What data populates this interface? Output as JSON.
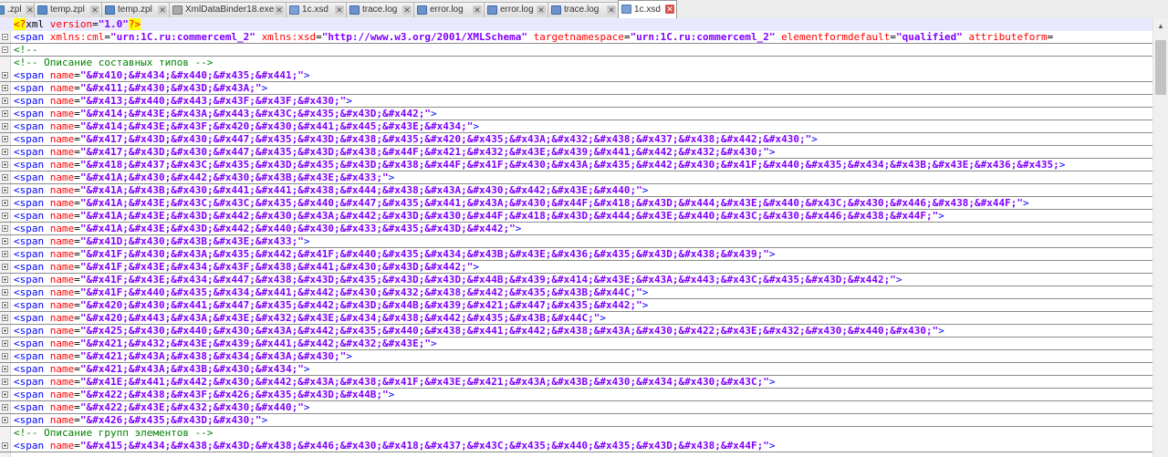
{
  "tabs": [
    {
      "label": ".zpl",
      "type": "zpl",
      "active": false
    },
    {
      "label": "temp.zpl",
      "type": "zpl",
      "active": false
    },
    {
      "label": "temp.zpl",
      "type": "zpl",
      "active": false
    },
    {
      "label": "XmlDataBinder18.exe",
      "type": "exe",
      "active": false
    },
    {
      "label": "1c.xsd",
      "type": "xsd",
      "active": false
    },
    {
      "label": "trace.log",
      "type": "log",
      "active": false
    },
    {
      "label": "error.log",
      "type": "log",
      "active": false
    },
    {
      "label": "error.log",
      "type": "log",
      "active": false
    },
    {
      "label": "trace.log",
      "type": "log",
      "active": false
    },
    {
      "label": "1c.xsd",
      "type": "xsd",
      "active": true
    }
  ],
  "tab_close_glyph": "✕",
  "editor": {
    "xml_decl": {
      "open": "<?",
      "name": "xml",
      "attr": "version",
      "value": "\"1.0\"",
      "close": "?>"
    },
    "root_line": {
      "tag": "<span",
      "attrs": [
        {
          "name": "xmlns:cml",
          "value": "\"urn:1C.ru:commerceml_2\""
        },
        {
          "name": "xmlns:xsd",
          "value": "\"http://www.w3.org/2001/XMLSchema\""
        },
        {
          "name": "targetnamespace",
          "value": "\"urn:1C.ru:commerceml_2\""
        },
        {
          "name": "elementformdefault",
          "value": "\"qualified\""
        },
        {
          "name": "attributeform",
          "value": ""
        }
      ]
    },
    "comment_open_line": "<!--",
    "comment_types": "<!-- Описание составных типов -->",
    "comment_groups": "<!-- Описание групп элементов -->",
    "span_tag": "<span",
    "attr_name": "name",
    "tag_end": ">",
    "type_names": [
      "\"&#x410;&#x434;&#x440;&#x435;&#x441;\"",
      "\"&#x411;&#x430;&#x43D;&#x43A;\"",
      "\"&#x413;&#x440;&#x443;&#x43F;&#x43F;&#x430;\"",
      "\"&#x414;&#x43E;&#x43A;&#x443;&#x43C;&#x435;&#x43D;&#x442;\"",
      "\"&#x414;&#x43E;&#x43F;&#x420;&#x430;&#x441;&#x445;&#x43E;&#x434;\"",
      "\"&#x417;&#x43D;&#x430;&#x447;&#x435;&#x43D;&#x438;&#x435;&#x420;&#x435;&#x43A;&#x432;&#x438;&#x437;&#x438;&#x442;&#x430;\"",
      "\"&#x417;&#x43D;&#x430;&#x447;&#x435;&#x43D;&#x438;&#x44F;&#x421;&#x432;&#x43E;&#x439;&#x441;&#x442;&#x432;&#x430;\"",
      "\"&#x418;&#x437;&#x43C;&#x435;&#x43D;&#x435;&#x43D;&#x438;&#x44F;&#x41F;&#x430;&#x43A;&#x435;&#x442;&#x430;&#x41F;&#x440;&#x435;&#x434;&#x43B;&#x43E;&#x436;&#x435;",
      "\"&#x41A;&#x430;&#x442;&#x430;&#x43B;&#x43E;&#x433;\"",
      "\"&#x41A;&#x43B;&#x430;&#x441;&#x441;&#x438;&#x444;&#x438;&#x43A;&#x430;&#x442;&#x43E;&#x440;\"",
      "\"&#x41A;&#x43E;&#x43C;&#x43C;&#x435;&#x440;&#x447;&#x435;&#x441;&#x43A;&#x430;&#x44F;&#x418;&#x43D;&#x444;&#x43E;&#x440;&#x43C;&#x430;&#x446;&#x438;&#x44F;\"",
      "\"&#x41A;&#x43E;&#x43D;&#x442;&#x430;&#x43A;&#x442;&#x43D;&#x430;&#x44F;&#x418;&#x43D;&#x444;&#x43E;&#x440;&#x43C;&#x430;&#x446;&#x438;&#x44F;\"",
      "\"&#x41A;&#x43E;&#x43D;&#x442;&#x440;&#x430;&#x433;&#x435;&#x43D;&#x442;\"",
      "\"&#x41D;&#x430;&#x43B;&#x43E;&#x433;\"",
      "\"&#x41F;&#x430;&#x43A;&#x435;&#x442;&#x41F;&#x440;&#x435;&#x434;&#x43B;&#x43E;&#x436;&#x435;&#x43D;&#x438;&#x439;\"",
      "\"&#x41F;&#x43E;&#x434;&#x43F;&#x438;&#x441;&#x430;&#x43D;&#x442;\"",
      "\"&#x41F;&#x43E;&#x434;&#x447;&#x438;&#x43D;&#x435;&#x43D;&#x43D;&#x44B;&#x439;&#x414;&#x43E;&#x43A;&#x443;&#x43C;&#x435;&#x43D;&#x442;\"",
      "\"&#x41F;&#x440;&#x435;&#x434;&#x441;&#x442;&#x430;&#x432;&#x438;&#x442;&#x435;&#x43B;&#x44C;\"",
      "\"&#x420;&#x430;&#x441;&#x447;&#x435;&#x442;&#x43D;&#x44B;&#x439;&#x421;&#x447;&#x435;&#x442;\"",
      "\"&#x420;&#x443;&#x43A;&#x43E;&#x432;&#x43E;&#x434;&#x438;&#x442;&#x435;&#x43B;&#x44C;\"",
      "\"&#x425;&#x430;&#x440;&#x430;&#x43A;&#x442;&#x435;&#x440;&#x438;&#x441;&#x442;&#x438;&#x43A;&#x430;&#x422;&#x43E;&#x432;&#x430;&#x440;&#x430;\"",
      "\"&#x421;&#x432;&#x43E;&#x439;&#x441;&#x442;&#x432;&#x43E;\"",
      "\"&#x421;&#x43A;&#x438;&#x434;&#x43A;&#x430;\"",
      "\"&#x421;&#x43A;&#x43B;&#x430;&#x434;\"",
      "\"&#x41E;&#x441;&#x442;&#x430;&#x442;&#x43A;&#x438;&#x41F;&#x43E;&#x421;&#x43A;&#x43B;&#x430;&#x434;&#x430;&#x43C;\"",
      "\"&#x422;&#x438;&#x43F;&#x426;&#x435;&#x43D;&#x44B;\"",
      "\"&#x422;&#x43E;&#x432;&#x430;&#x440;\"",
      "\"&#x426;&#x435;&#x43D;&#x430;\""
    ],
    "group_names": [
      "\"&#x415;&#x434;&#x438;&#x43D;&#x438;&#x446;&#x430;&#x418;&#x437;&#x43C;&#x435;&#x440;&#x435;&#x43D;&#x438;&#x44F;\""
    ]
  },
  "scrollbar": {
    "up_glyph": "▲"
  }
}
